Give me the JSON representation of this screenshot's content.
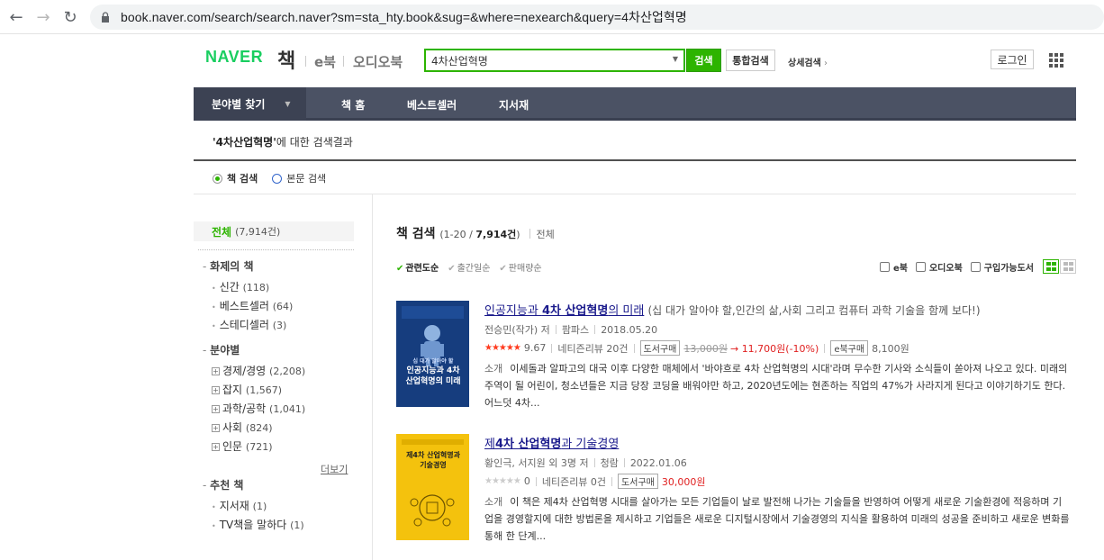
{
  "browser": {
    "url": "book.naver.com/search/search.naver?sm=sta_hty.book&sug=&where=nexearch&query=4차산업혁명"
  },
  "header": {
    "logo": "NAVER",
    "service": "책",
    "links": [
      "e북",
      "오디오북"
    ],
    "search_value": "4차산업혁명",
    "search_button": "검색",
    "all_search_button": "통합검색",
    "advanced_search": "상세검색",
    "login_button": "로그인"
  },
  "nav": {
    "category_menu": "분야별 찾기",
    "items": [
      "책 홈",
      "베스트셀러",
      "지서재"
    ]
  },
  "result": {
    "query": "'4차산업혁명'",
    "suffix": "에 대한 검색결과",
    "radio_book": "책 검색",
    "radio_text": "본문 검색"
  },
  "sidebar": {
    "all_label": "전체",
    "all_count": "(7,914건)",
    "groups": [
      {
        "title": "화제의 책",
        "items": [
          [
            "신간",
            "(118)"
          ],
          [
            "베스트셀러",
            "(64)"
          ],
          [
            "스테디셀러",
            "(3)"
          ]
        ]
      },
      {
        "title": "분야별",
        "items": [
          [
            "경제/경영",
            "(2,208)"
          ],
          [
            "잡지",
            "(1,567)"
          ],
          [
            "과학/공학",
            "(1,041)"
          ],
          [
            "사회",
            "(824)"
          ],
          [
            "인문",
            "(721)"
          ]
        ]
      },
      {
        "title": "추천 책",
        "items": [
          [
            "지서재",
            "(1)"
          ],
          [
            "TV책을 말하다",
            "(1)"
          ]
        ]
      }
    ],
    "more": "더보기"
  },
  "main": {
    "title": "책 검색",
    "range_prefix": "(1-20 / ",
    "range_total": "7,914건",
    "range_suffix": ")",
    "filter_all": "전체",
    "sort": [
      "관련도순",
      "출간일순",
      "판매량순"
    ],
    "filters": [
      "e북",
      "오디오북",
      "구입가능도서"
    ]
  },
  "books": [
    {
      "title_pre": "인공지능과 ",
      "title_bold": "4차 산업혁명",
      "title_post": "의 미래",
      "subtitle": "(십 대가 알아야 할,인간의 삶,사회 그리고 컴퓨터 과학 기술을 함께 보다!)",
      "author": "전승민(작가) 저",
      "publisher": "팜파스",
      "date": "2018.05.20",
      "rating": "9.67",
      "reviews": "네티즌리뷰 20건",
      "buy_tag": "도서구매",
      "list_price": "13,000원",
      "arrow": "→",
      "sale_price": "11,700원(-10%)",
      "ebook_tag": "e북구매",
      "ebook_price": "8,100원",
      "desc_label": "소개",
      "desc": "이세돌과 알파고의 대국 이후 다양한 매체에서 '바야흐로 4차 산업혁명의 시대'라며 무수한 기사와 소식들이 쏟아져 나오고 있다. 미래의 주역이 될 어린이, 청소년들은 지금 당장 코딩을 배워야만 하고, 2020년도에는 현존하는 직업의 47%가 사라지게 된다고 이야기하기도 한다. 어느덧 4차...",
      "cover_small": "십 대가 알아야 할",
      "cover_title": "인공지능과 4차 산업혁명의 미래"
    },
    {
      "title_pre": "제",
      "title_bold": "4차 산업혁명",
      "title_post": "과 기술경영",
      "subtitle": "",
      "author": "황인극, 서지원 외 3명 저",
      "publisher": "청람",
      "date": "2022.01.06",
      "rating": "0",
      "reviews": "네티즌리뷰 0건",
      "buy_tag": "도서구매",
      "sale_price": "30,000원",
      "desc_label": "소개",
      "desc": "이 책은 제4차 산업혁명 시대를 살아가는 모든 기업들이 날로 발전해 나가는 기술들을 반영하여 어떻게 새로운 기술환경에 적응하며 기업을 경영할지에 대한 방법론을 제시하고 기업들은 새로운 디지털시장에서 기술경영의 지식을 활용하여 미래의 성공을 준비하고 새로운 변화를 통해 한 단계...",
      "cover_title": "제4차 산업혁명과 기술경영"
    }
  ]
}
